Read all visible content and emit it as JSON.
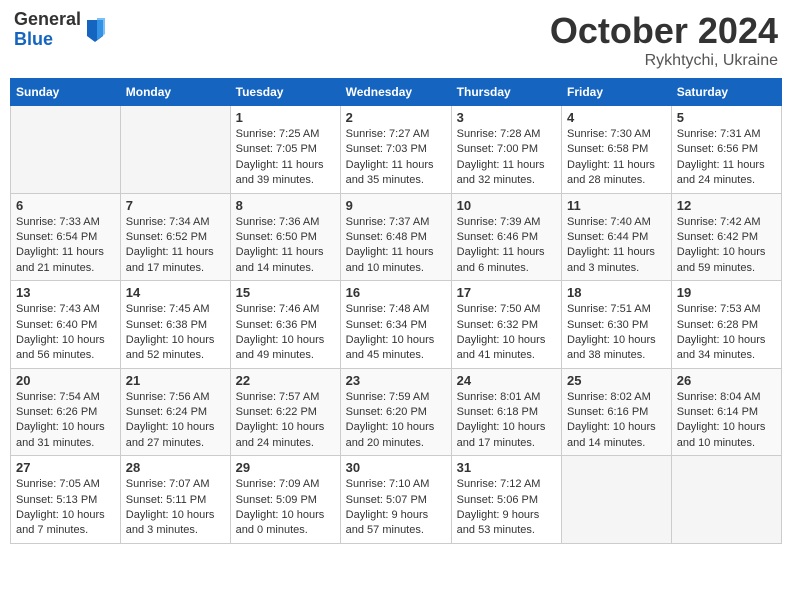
{
  "header": {
    "logo": {
      "general": "General",
      "blue": "Blue"
    },
    "title": "October 2024",
    "location": "Rykhtychi, Ukraine"
  },
  "weekdays": [
    "Sunday",
    "Monday",
    "Tuesday",
    "Wednesday",
    "Thursday",
    "Friday",
    "Saturday"
  ],
  "weeks": [
    [
      {
        "num": "",
        "empty": true
      },
      {
        "num": "",
        "empty": true
      },
      {
        "num": "1",
        "sunrise": "Sunrise: 7:25 AM",
        "sunset": "Sunset: 7:05 PM",
        "daylight": "Daylight: 11 hours and 39 minutes."
      },
      {
        "num": "2",
        "sunrise": "Sunrise: 7:27 AM",
        "sunset": "Sunset: 7:03 PM",
        "daylight": "Daylight: 11 hours and 35 minutes."
      },
      {
        "num": "3",
        "sunrise": "Sunrise: 7:28 AM",
        "sunset": "Sunset: 7:00 PM",
        "daylight": "Daylight: 11 hours and 32 minutes."
      },
      {
        "num": "4",
        "sunrise": "Sunrise: 7:30 AM",
        "sunset": "Sunset: 6:58 PM",
        "daylight": "Daylight: 11 hours and 28 minutes."
      },
      {
        "num": "5",
        "sunrise": "Sunrise: 7:31 AM",
        "sunset": "Sunset: 6:56 PM",
        "daylight": "Daylight: 11 hours and 24 minutes."
      }
    ],
    [
      {
        "num": "6",
        "sunrise": "Sunrise: 7:33 AM",
        "sunset": "Sunset: 6:54 PM",
        "daylight": "Daylight: 11 hours and 21 minutes."
      },
      {
        "num": "7",
        "sunrise": "Sunrise: 7:34 AM",
        "sunset": "Sunset: 6:52 PM",
        "daylight": "Daylight: 11 hours and 17 minutes."
      },
      {
        "num": "8",
        "sunrise": "Sunrise: 7:36 AM",
        "sunset": "Sunset: 6:50 PM",
        "daylight": "Daylight: 11 hours and 14 minutes."
      },
      {
        "num": "9",
        "sunrise": "Sunrise: 7:37 AM",
        "sunset": "Sunset: 6:48 PM",
        "daylight": "Daylight: 11 hours and 10 minutes."
      },
      {
        "num": "10",
        "sunrise": "Sunrise: 7:39 AM",
        "sunset": "Sunset: 6:46 PM",
        "daylight": "Daylight: 11 hours and 6 minutes."
      },
      {
        "num": "11",
        "sunrise": "Sunrise: 7:40 AM",
        "sunset": "Sunset: 6:44 PM",
        "daylight": "Daylight: 11 hours and 3 minutes."
      },
      {
        "num": "12",
        "sunrise": "Sunrise: 7:42 AM",
        "sunset": "Sunset: 6:42 PM",
        "daylight": "Daylight: 10 hours and 59 minutes."
      }
    ],
    [
      {
        "num": "13",
        "sunrise": "Sunrise: 7:43 AM",
        "sunset": "Sunset: 6:40 PM",
        "daylight": "Daylight: 10 hours and 56 minutes."
      },
      {
        "num": "14",
        "sunrise": "Sunrise: 7:45 AM",
        "sunset": "Sunset: 6:38 PM",
        "daylight": "Daylight: 10 hours and 52 minutes."
      },
      {
        "num": "15",
        "sunrise": "Sunrise: 7:46 AM",
        "sunset": "Sunset: 6:36 PM",
        "daylight": "Daylight: 10 hours and 49 minutes."
      },
      {
        "num": "16",
        "sunrise": "Sunrise: 7:48 AM",
        "sunset": "Sunset: 6:34 PM",
        "daylight": "Daylight: 10 hours and 45 minutes."
      },
      {
        "num": "17",
        "sunrise": "Sunrise: 7:50 AM",
        "sunset": "Sunset: 6:32 PM",
        "daylight": "Daylight: 10 hours and 41 minutes."
      },
      {
        "num": "18",
        "sunrise": "Sunrise: 7:51 AM",
        "sunset": "Sunset: 6:30 PM",
        "daylight": "Daylight: 10 hours and 38 minutes."
      },
      {
        "num": "19",
        "sunrise": "Sunrise: 7:53 AM",
        "sunset": "Sunset: 6:28 PM",
        "daylight": "Daylight: 10 hours and 34 minutes."
      }
    ],
    [
      {
        "num": "20",
        "sunrise": "Sunrise: 7:54 AM",
        "sunset": "Sunset: 6:26 PM",
        "daylight": "Daylight: 10 hours and 31 minutes."
      },
      {
        "num": "21",
        "sunrise": "Sunrise: 7:56 AM",
        "sunset": "Sunset: 6:24 PM",
        "daylight": "Daylight: 10 hours and 27 minutes."
      },
      {
        "num": "22",
        "sunrise": "Sunrise: 7:57 AM",
        "sunset": "Sunset: 6:22 PM",
        "daylight": "Daylight: 10 hours and 24 minutes."
      },
      {
        "num": "23",
        "sunrise": "Sunrise: 7:59 AM",
        "sunset": "Sunset: 6:20 PM",
        "daylight": "Daylight: 10 hours and 20 minutes."
      },
      {
        "num": "24",
        "sunrise": "Sunrise: 8:01 AM",
        "sunset": "Sunset: 6:18 PM",
        "daylight": "Daylight: 10 hours and 17 minutes."
      },
      {
        "num": "25",
        "sunrise": "Sunrise: 8:02 AM",
        "sunset": "Sunset: 6:16 PM",
        "daylight": "Daylight: 10 hours and 14 minutes."
      },
      {
        "num": "26",
        "sunrise": "Sunrise: 8:04 AM",
        "sunset": "Sunset: 6:14 PM",
        "daylight": "Daylight: 10 hours and 10 minutes."
      }
    ],
    [
      {
        "num": "27",
        "sunrise": "Sunrise: 7:05 AM",
        "sunset": "Sunset: 5:13 PM",
        "daylight": "Daylight: 10 hours and 7 minutes."
      },
      {
        "num": "28",
        "sunrise": "Sunrise: 7:07 AM",
        "sunset": "Sunset: 5:11 PM",
        "daylight": "Daylight: 10 hours and 3 minutes."
      },
      {
        "num": "29",
        "sunrise": "Sunrise: 7:09 AM",
        "sunset": "Sunset: 5:09 PM",
        "daylight": "Daylight: 10 hours and 0 minutes."
      },
      {
        "num": "30",
        "sunrise": "Sunrise: 7:10 AM",
        "sunset": "Sunset: 5:07 PM",
        "daylight": "Daylight: 9 hours and 57 minutes."
      },
      {
        "num": "31",
        "sunrise": "Sunrise: 7:12 AM",
        "sunset": "Sunset: 5:06 PM",
        "daylight": "Daylight: 9 hours and 53 minutes."
      },
      {
        "num": "",
        "empty": true
      },
      {
        "num": "",
        "empty": true
      }
    ]
  ]
}
